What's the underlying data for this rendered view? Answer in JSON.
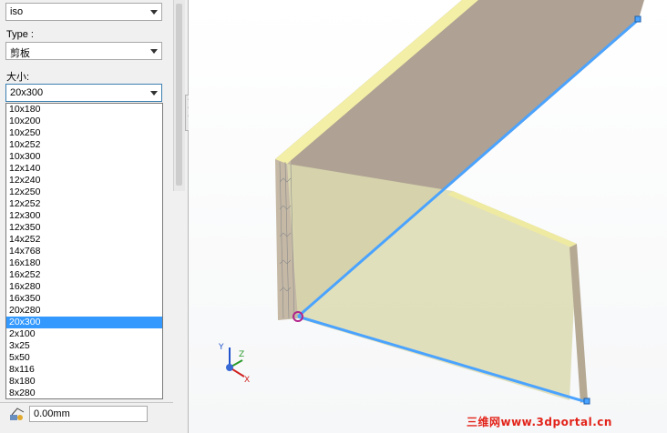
{
  "panel": {
    "view_combo": {
      "value": "iso"
    },
    "type_label": "Type :",
    "type_combo": {
      "value": "剪板"
    },
    "size_label": "大小:",
    "size_combo": {
      "value": "20x300"
    },
    "size_options": [
      "10x180",
      "10x200",
      "10x250",
      "10x252",
      "10x300",
      "12x140",
      "12x240",
      "12x250",
      "12x252",
      "12x300",
      "12x350",
      "14x252",
      "14x768",
      "16x180",
      "16x252",
      "16x280",
      "16x350",
      "20x280",
      "20x300",
      "2x100",
      "3x25",
      "5x50",
      "8x116",
      "8x180",
      "8x280"
    ],
    "selected_option": "20x300",
    "offset_field": {
      "value": "0.00mm"
    }
  },
  "viewport": {
    "triad_labels": {
      "x": "X",
      "y": "Y",
      "z": "Z"
    }
  },
  "watermark": "三维网www.3dportal.cn",
  "colors": {
    "selection_blue": "#3399ff",
    "edge_highlight": "#4aa3ff",
    "plate_face": "#a59887",
    "plate_edge": "#f3efa6"
  }
}
